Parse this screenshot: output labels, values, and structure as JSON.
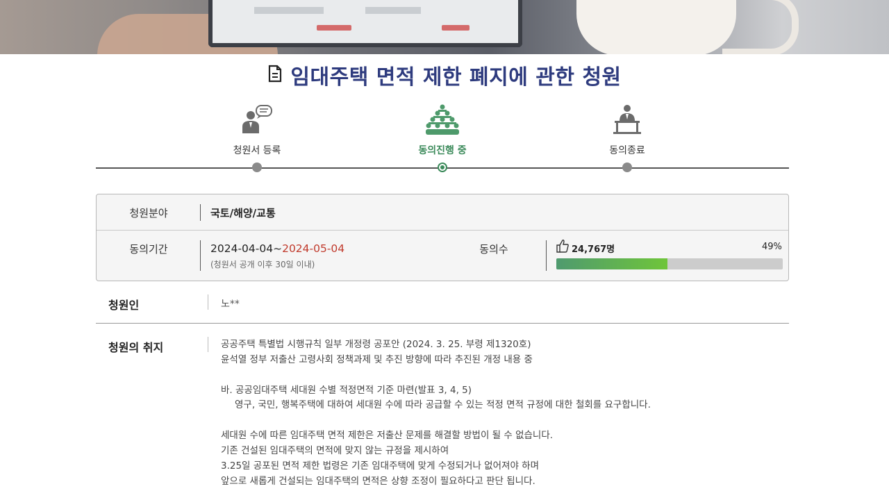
{
  "title": "임대주택 면적 제한 폐지에 관한 청원",
  "steps": [
    {
      "label": "청원서 등록",
      "state": "done",
      "icon": "petition-register-icon"
    },
    {
      "label": "동의진행 중",
      "state": "active",
      "icon": "group-agree-icon"
    },
    {
      "label": "동의종료",
      "state": "pending",
      "icon": "podium-speaker-icon"
    }
  ],
  "info": {
    "category_label": "청원분야",
    "category_value": "국토/해양/교통",
    "period_label": "동의기간",
    "period_start": "2024-04-04~",
    "period_end": "2024-05-04",
    "period_note": "(청원서 공개 이후 30일 이내)",
    "agree_label": "동의수",
    "agree_count": "24,767명",
    "agree_percent_text": "49%",
    "agree_progress": 0.49
  },
  "petitioner": {
    "label": "청원인",
    "value": "노**"
  },
  "purpose": {
    "label": "청원의 취지",
    "lines": [
      "공공주택 특별법 시행규칙 일부 개정령 공포안 (2024. 3. 25. 부령 제1320호)",
      "윤석열 정부 저출산 고령사회 정책과제 및 추진 방향에 따라 추진된 개정 내용 중",
      "",
      "바. 공공임대주택 세대원 수별 적정면적 기준 마련(발표 3, 4, 5)",
      "영구, 국민, 행복주택에 대하여 세대원 수에 따라 공급할 수 있는 적정 면적 규정에 대한 철회를 요구합니다.",
      "",
      "세대원 수에 따른 임대주택 면적 제한은 저출산 문제를 해결할 방법이 될 수 없습니다.",
      "기존 건설된 임대주택의 면적에 맞지 않는 규정을 제시하여",
      "3.25일 공포된 면적 제한 법령은 기존 임대주택에 맞게 수정되거나 없어져야 하며",
      "앞으로 새롭게 건설되는 임대주택의 면적은 상향 조정이 필요하다고 판단 됩니다."
    ]
  },
  "colors": {
    "title": "#2e3b7e",
    "active_step": "#3b8a5a",
    "end_date": "#c0392b",
    "progress_fill": "#6fc53a",
    "progress_track": "#cccccc"
  }
}
